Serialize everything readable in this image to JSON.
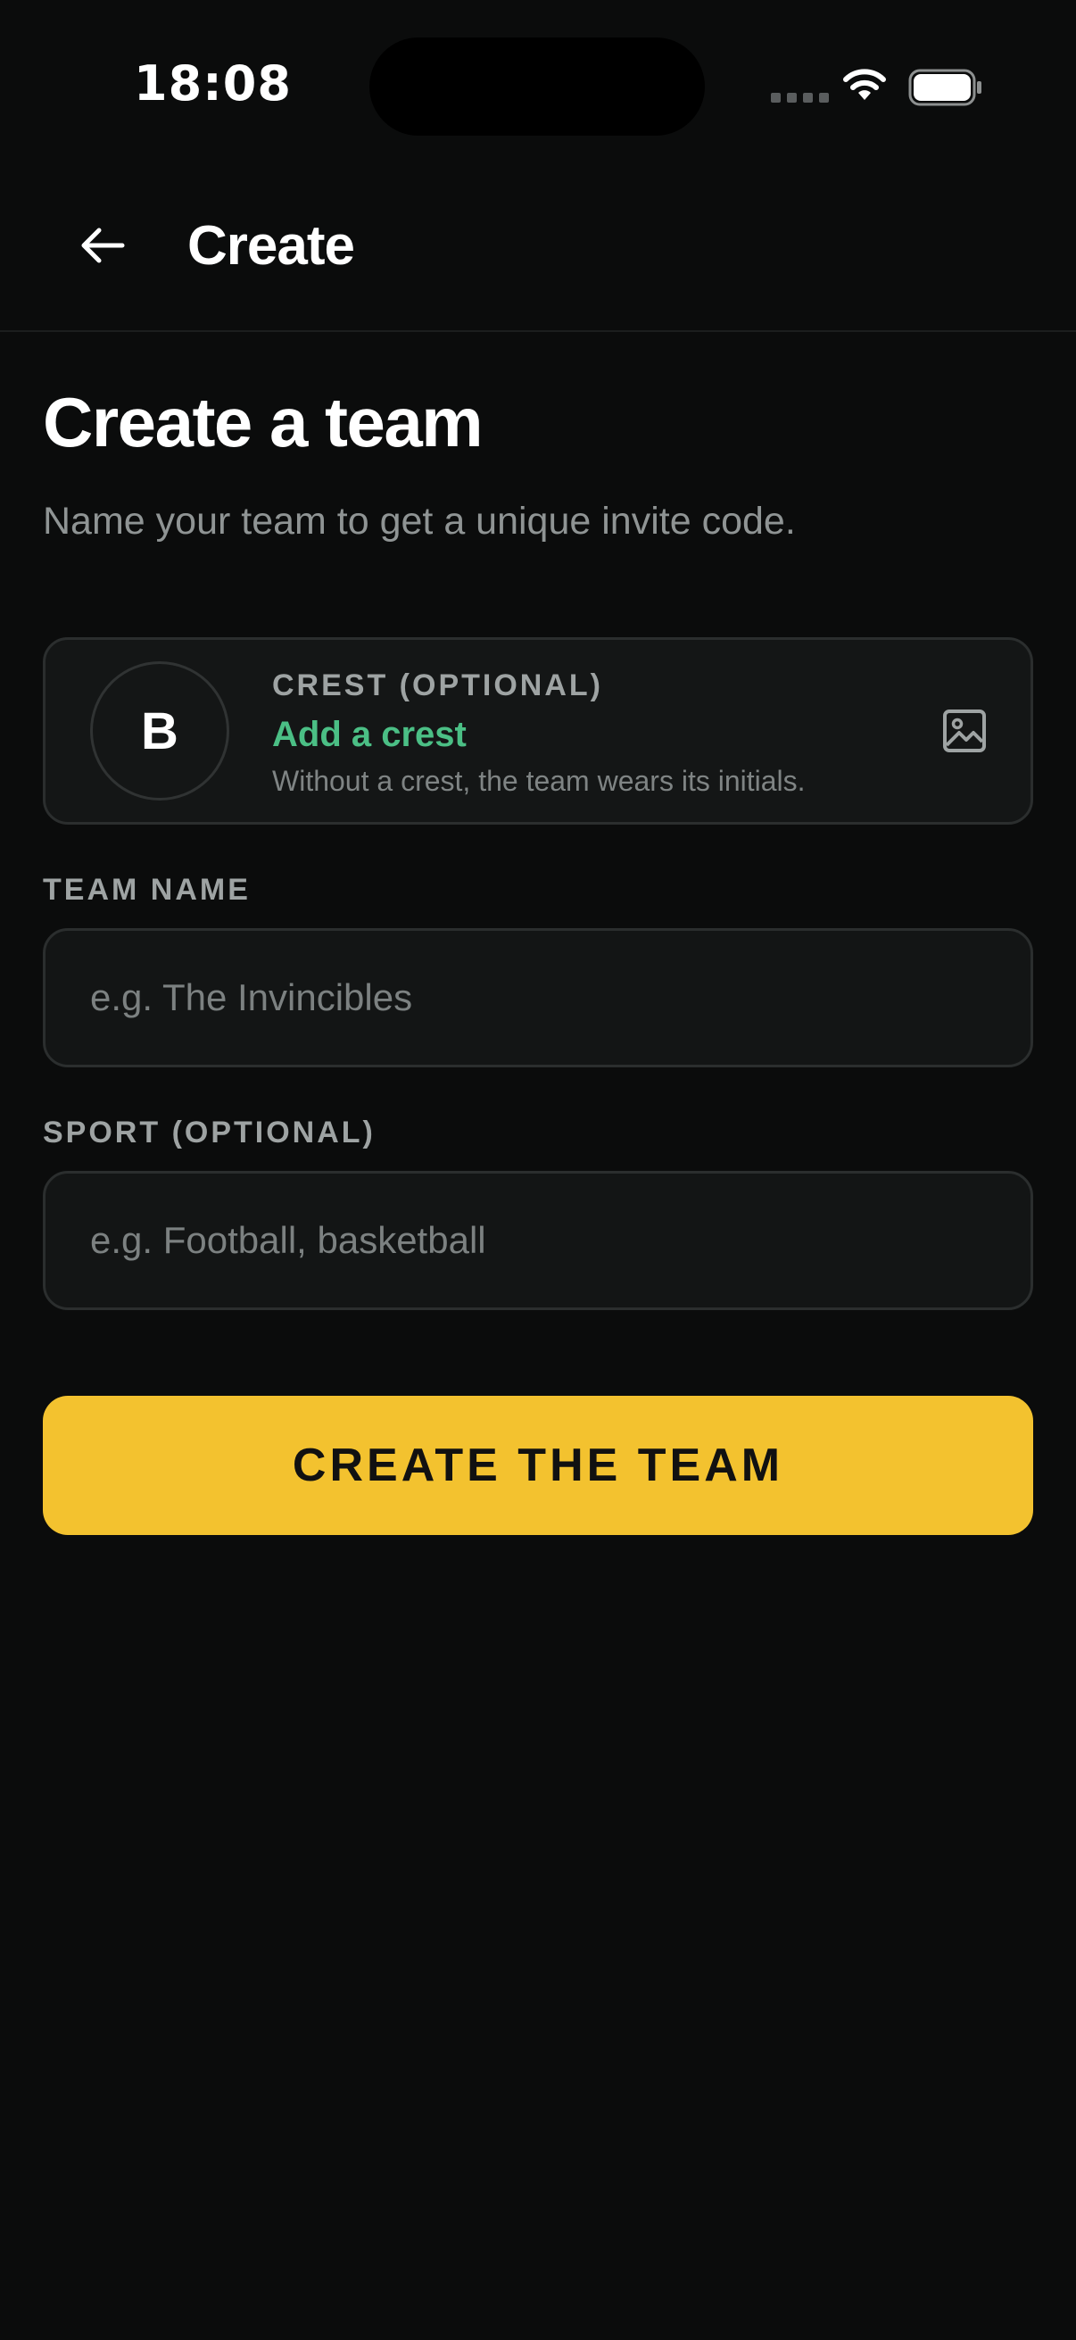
{
  "status_bar": {
    "time": "18:08",
    "icons": [
      "signal-icon",
      "wifi-icon",
      "battery-icon"
    ]
  },
  "header": {
    "back_icon": "arrow-left-icon",
    "title": "Create"
  },
  "main": {
    "title": "Create a team",
    "subtitle": "Name your team to get a unique invite code."
  },
  "crest": {
    "label": "CREST (OPTIONAL)",
    "initials": "B",
    "action": "Add a crest",
    "hint": "Without a crest, the team wears its initials.",
    "icon": "image-icon"
  },
  "form": {
    "team_name": {
      "label": "TEAM NAME",
      "value": "",
      "placeholder": "e.g. The Invincibles"
    },
    "sport": {
      "label": "SPORT (OPTIONAL)",
      "value": "",
      "placeholder": "e.g. Football, basketball"
    }
  },
  "actions": {
    "submit_label": "CREATE THE TEAM"
  },
  "colors": {
    "background": "#0b0c0c",
    "accent": "#f3c22f",
    "link": "#4bbf85",
    "card": "#141616",
    "border": "#2b2e2e"
  }
}
